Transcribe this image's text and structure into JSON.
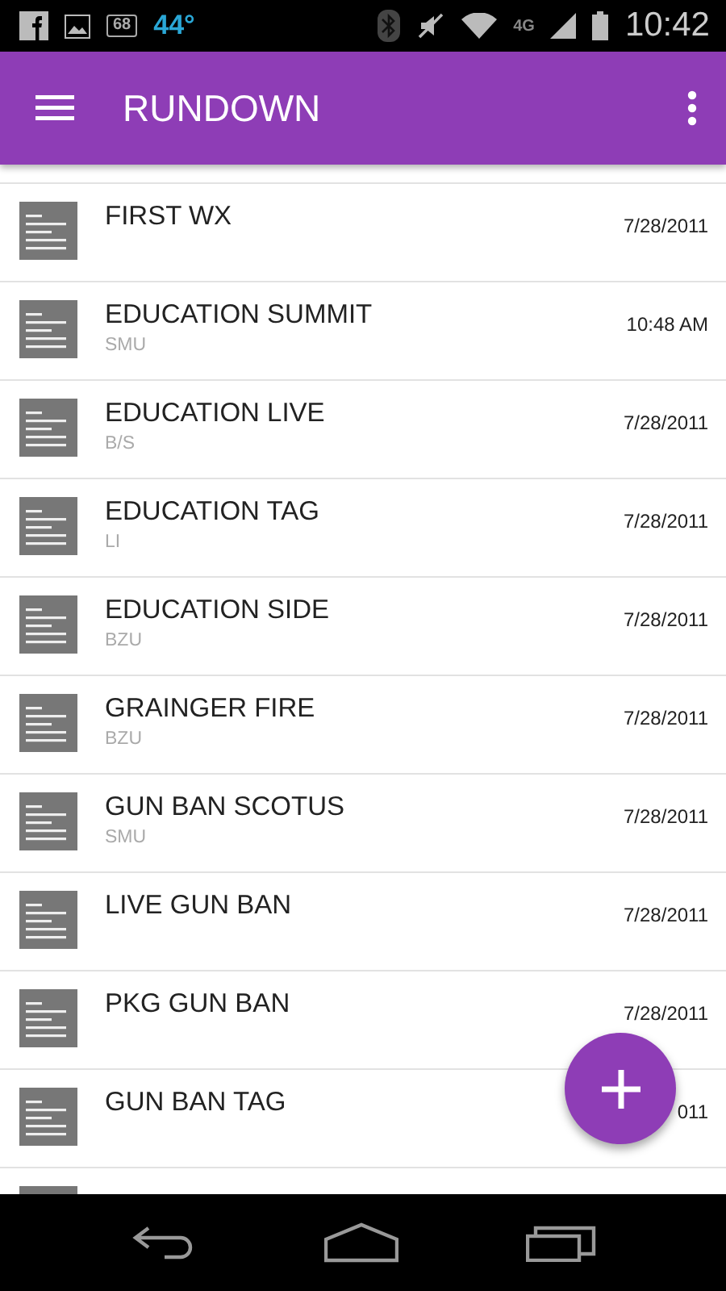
{
  "status_bar": {
    "battery_level_text": "68",
    "temperature": "44°",
    "network": "4G",
    "time": "10:42"
  },
  "app_bar": {
    "title": "RUNDOWN"
  },
  "rows": [
    {
      "title": "FIRST WX",
      "subtitle": "",
      "date": "7/28/2011"
    },
    {
      "title": "EDUCATION SUMMIT",
      "subtitle": "SMU",
      "date": "10:48 AM"
    },
    {
      "title": "EDUCATION LIVE",
      "subtitle": "B/S",
      "date": "7/28/2011"
    },
    {
      "title": "EDUCATION TAG",
      "subtitle": "LI",
      "date": "7/28/2011"
    },
    {
      "title": "EDUCATION SIDE",
      "subtitle": "BZU",
      "date": "7/28/2011"
    },
    {
      "title": "GRAINGER FIRE",
      "subtitle": "BZU",
      "date": "7/28/2011"
    },
    {
      "title": "GUN BAN SCOTUS",
      "subtitle": "SMU",
      "date": "7/28/2011"
    },
    {
      "title": "LIVE GUN BAN",
      "subtitle": "",
      "date": "7/28/2011"
    },
    {
      "title": "PKG GUN BAN",
      "subtitle": "",
      "date": "7/28/2011"
    },
    {
      "title": "GUN BAN TAG",
      "subtitle": "",
      "date": "011"
    },
    {
      "title": "",
      "subtitle": "",
      "date": ""
    }
  ]
}
